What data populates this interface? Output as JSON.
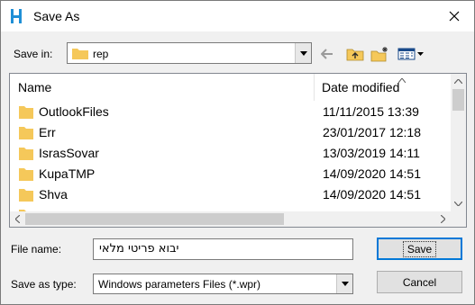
{
  "window": {
    "title": "Save As"
  },
  "toolbar": {
    "save_in_label": "Save in:",
    "save_in_value": "rep"
  },
  "list": {
    "columns": {
      "name": "Name",
      "date": "Date modified"
    },
    "rows": [
      {
        "name": "OutlookFiles",
        "date": "11/11/2015 13:39"
      },
      {
        "name": "Err",
        "date": "23/01/2017 12:18"
      },
      {
        "name": "IsrasSovar",
        "date": "13/03/2019 14:11"
      },
      {
        "name": "KupaTMP",
        "date": "14/09/2020 14:51"
      },
      {
        "name": "Shva",
        "date": "14/09/2020 14:51"
      }
    ]
  },
  "form": {
    "file_name_label": "File name:",
    "file_name_value": "יבוא פריטי מלאי",
    "save_type_label": "Save as type:",
    "save_type_value": "Windows parameters Files (*.wpr)"
  },
  "buttons": {
    "save": "Save",
    "cancel": "Cancel"
  },
  "colors": {
    "folder": "#f5c85a",
    "accent": "#0078d7",
    "app_icon": "#1f8fd6"
  },
  "icons": {
    "app": "app-logo-icon",
    "close": "close-icon",
    "back": "back-arrow-icon",
    "up": "up-folder-icon",
    "new_folder": "new-folder-icon",
    "view": "view-menu-icon"
  }
}
